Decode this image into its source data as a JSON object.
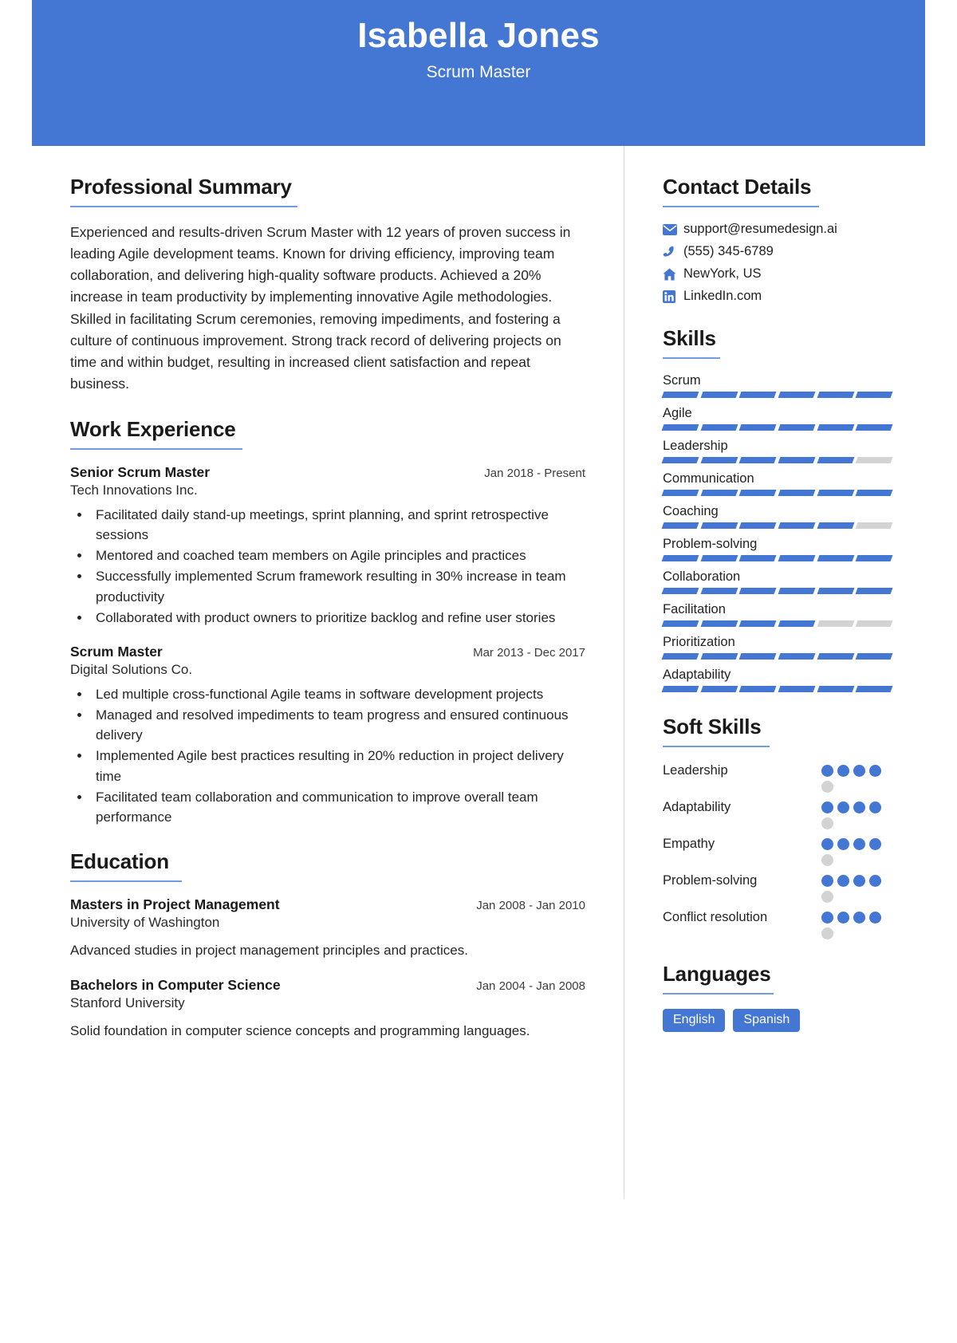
{
  "theme": {
    "accent": "#4477d4",
    "rule": "#6f9ce4",
    "track": "#d3d3d3",
    "text": "#222222"
  },
  "header": {
    "name": "Isabella Jones",
    "role": "Scrum Master"
  },
  "summary": {
    "title": "Professional Summary",
    "text": "Experienced and results-driven Scrum Master with 12 years of proven success in leading Agile development teams. Known for driving efficiency, improving team collaboration, and delivering high-quality software products. Achieved a 20% increase in team productivity by implementing innovative Agile methodologies. Skilled in facilitating Scrum ceremonies, removing impediments, and fostering a culture of continuous improvement. Strong track record of delivering projects on time and within budget, resulting in increased client satisfaction and repeat business."
  },
  "work": {
    "title": "Work Experience",
    "entries": [
      {
        "role": "Senior Scrum Master",
        "company": "Tech Innovations Inc.",
        "date": "Jan 2018 - Present",
        "bullets": [
          "Facilitated daily stand-up meetings, sprint planning, and sprint retrospective sessions",
          "Mentored and coached team members on Agile principles and practices",
          "Successfully implemented Scrum framework resulting in 30% increase in team productivity",
          "Collaborated with product owners to prioritize backlog and refine user stories"
        ]
      },
      {
        "role": "Scrum Master",
        "company": "Digital Solutions Co.",
        "date": "Mar 2013 - Dec 2017",
        "bullets": [
          "Led multiple cross-functional Agile teams in software development projects",
          "Managed and resolved impediments to team progress and ensured continuous delivery",
          "Implemented Agile best practices resulting in 20% reduction in project delivery time",
          "Facilitated team collaboration and communication to improve overall team performance"
        ]
      }
    ]
  },
  "education": {
    "title": "Education",
    "entries": [
      {
        "degree": "Masters in Project Management",
        "school": "University of Washington",
        "date": "Jan 2008 - Jan 2010",
        "desc": "Advanced studies in project management principles and practices."
      },
      {
        "degree": "Bachelors in Computer Science",
        "school": "Stanford University",
        "date": "Jan 2004 - Jan 2008",
        "desc": "Solid foundation in computer science concepts and programming languages."
      }
    ]
  },
  "contact": {
    "title": "Contact Details",
    "items": [
      {
        "icon": "envelope-icon",
        "value": "support@resumedesign.ai"
      },
      {
        "icon": "phone-icon",
        "value": "(555) 345-6789"
      },
      {
        "icon": "home-icon",
        "value": "NewYork, US"
      },
      {
        "icon": "linkedin-icon",
        "value": "LinkedIn.com"
      }
    ]
  },
  "skills": {
    "title": "Skills",
    "segments_total": 6,
    "items": [
      {
        "name": "Scrum",
        "filled": 6
      },
      {
        "name": "Agile",
        "filled": 6
      },
      {
        "name": "Leadership",
        "filled": 5
      },
      {
        "name": "Communication",
        "filled": 6
      },
      {
        "name": "Coaching",
        "filled": 5
      },
      {
        "name": "Problem-solving",
        "filled": 6
      },
      {
        "name": "Collaboration",
        "filled": 6
      },
      {
        "name": "Facilitation",
        "filled": 4
      },
      {
        "name": "Prioritization",
        "filled": 6
      },
      {
        "name": "Adaptability",
        "filled": 6
      }
    ]
  },
  "soft_skills": {
    "title": "Soft Skills",
    "dots_total": 5,
    "items": [
      {
        "name": "Leadership",
        "filled": 4
      },
      {
        "name": "Adaptability",
        "filled": 4
      },
      {
        "name": "Empathy",
        "filled": 4
      },
      {
        "name": "Problem-solving",
        "filled": 4
      },
      {
        "name": "Conflict resolution",
        "filled": 4
      }
    ]
  },
  "languages": {
    "title": "Languages",
    "items": [
      "English",
      "Spanish"
    ]
  }
}
